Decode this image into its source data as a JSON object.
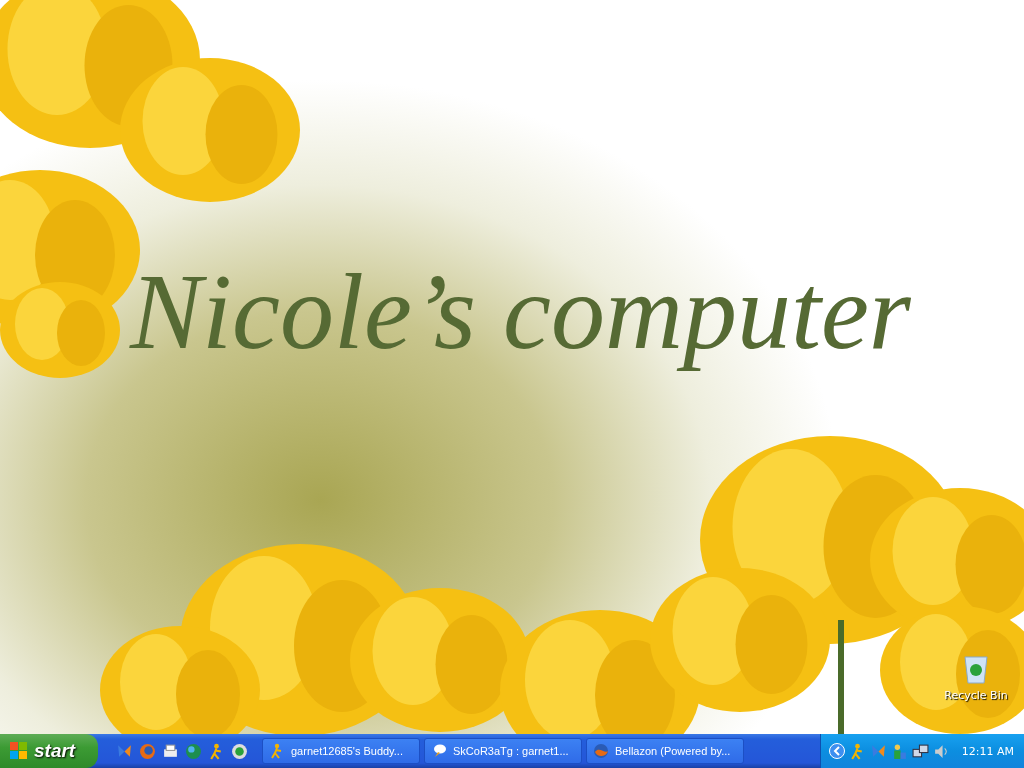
{
  "desktop": {
    "wallpaper_text": "Nicole’s computer",
    "icons": [
      {
        "label": "Recycle Bin"
      }
    ]
  },
  "taskbar": {
    "start_label": "start",
    "tasks": [
      {
        "label": "garnet12685's Buddy...",
        "kind": "buddy"
      },
      {
        "label": "SkCoR3aTg : garnet1...",
        "kind": "chat"
      },
      {
        "label": "Bellazon (Powered by...",
        "kind": "browser"
      }
    ],
    "clock": "12:11 AM"
  }
}
